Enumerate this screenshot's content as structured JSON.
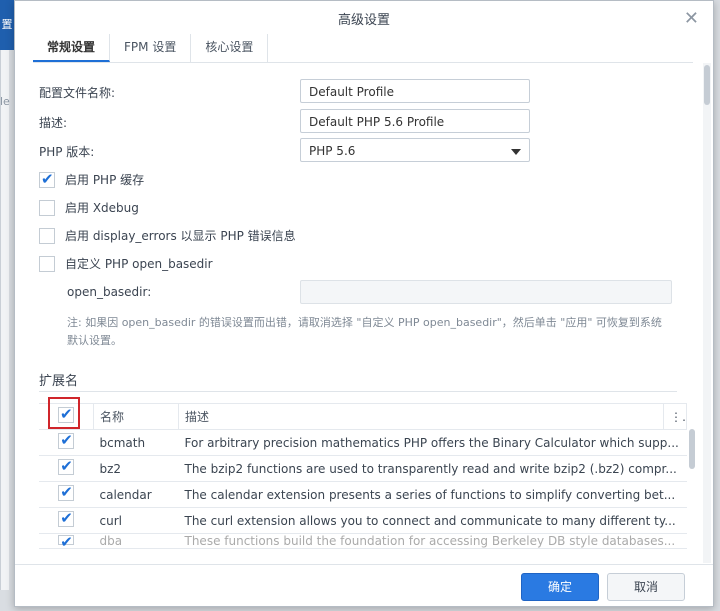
{
  "dialog": {
    "title": "高级设置"
  },
  "tabs": [
    {
      "label": "常规设置"
    },
    {
      "label": "FPM 设置"
    },
    {
      "label": "核心设置"
    }
  ],
  "form": {
    "profile_name_label": "配置文件名称:",
    "profile_name_value": "Default Profile",
    "description_label": "描述:",
    "description_value": "Default PHP 5.6 Profile",
    "php_version_label": "PHP 版本:",
    "php_version_value": "PHP 5.6",
    "enable_cache_label": "启用 PHP 缓存",
    "enable_cache_checked": true,
    "enable_xdebug_label": "启用 Xdebug",
    "enable_xdebug_checked": false,
    "display_errors_label": "启用 display_errors 以显示 PHP 错误信息",
    "display_errors_checked": false,
    "custom_basedir_label": "自定义 PHP open_basedir",
    "custom_basedir_checked": false,
    "open_basedir_label": "open_basedir:",
    "open_basedir_value": "",
    "note_line1": "注: 如果因 open_basedir 的错误设置而出错，请取消选择 \"自定义 PHP open_basedir\"，然后单击 \"应用\" 可恢复到系统",
    "note_line2": "默认设置。"
  },
  "extensions": {
    "section_title": "扩展名",
    "header": {
      "name": "名称",
      "description": "描述",
      "menu": "⋮"
    },
    "select_all_checked": true,
    "rows": [
      {
        "name": "bcmath",
        "description": "For arbitrary precision mathematics PHP offers the Binary Calculator which supp...",
        "checked": true
      },
      {
        "name": "bz2",
        "description": "The bzip2 functions are used to transparently read and write bzip2 (.bz2) compr...",
        "checked": true
      },
      {
        "name": "calendar",
        "description": "The calendar extension presents a series of functions to simplify converting bet...",
        "checked": true
      },
      {
        "name": "curl",
        "description": "The curl extension allows you to connect and communicate to many different ty...",
        "checked": true
      },
      {
        "name": "dba",
        "description": "These functions build the foundation for accessing Berkeley DB style databases...",
        "checked": true
      }
    ]
  },
  "footer": {
    "ok_label": "确定",
    "cancel_label": "取消"
  },
  "background": {
    "left_tab_text": "置",
    "right_mark": "le"
  },
  "colors": {
    "accent": "#2a7ae2",
    "highlight": "#d0252b",
    "check": "#1e6fd6"
  }
}
